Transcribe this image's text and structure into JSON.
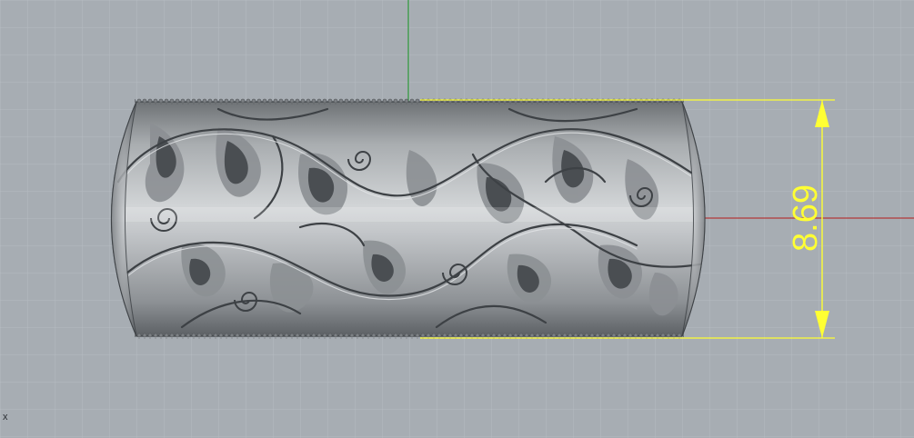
{
  "viewport": {
    "view": "front",
    "background_color": "#a7adb3",
    "grid_color": "#b5bbc1",
    "x_axis_color": "#b33a3a",
    "y_axis_color": "#2f9a3a",
    "corner_glyph": "x"
  },
  "object": {
    "kind": "filigree-ring",
    "material_color": "#9ea2a6"
  },
  "dimension": {
    "orientation": "vertical",
    "value": "8.69",
    "color": "#ffff33"
  }
}
